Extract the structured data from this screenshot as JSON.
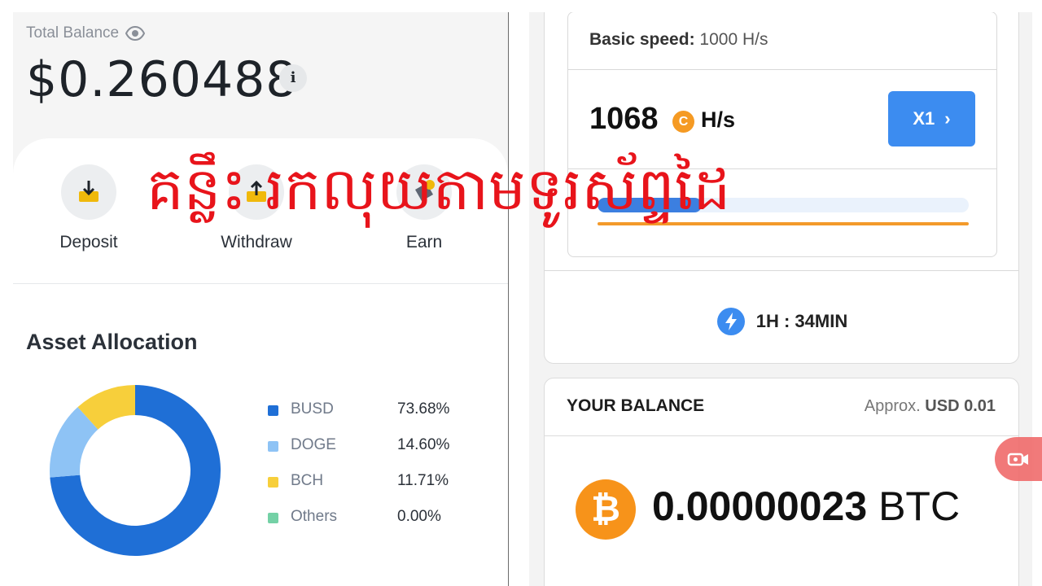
{
  "wallet": {
    "total_balance_label": "Total Balance",
    "balance_value": "$0.260488",
    "info_glyph": "i",
    "actions": [
      {
        "label": "Deposit",
        "icon": "deposit-icon"
      },
      {
        "label": "Withdraw",
        "icon": "withdraw-icon"
      },
      {
        "label": "Earn",
        "icon": "earn-icon"
      }
    ]
  },
  "allocation": {
    "title": "Asset Allocation",
    "items": [
      {
        "name": "BUSD",
        "value": "73.68%",
        "color": "#1f6fd6"
      },
      {
        "name": "DOGE",
        "value": "14.60%",
        "color": "#8ec3f5"
      },
      {
        "name": "BCH",
        "value": "11.71%",
        "color": "#f7cf3b"
      },
      {
        "name": "Others",
        "value": "0.00%",
        "color": "#74d1a6"
      }
    ]
  },
  "chart_data": {
    "type": "pie",
    "categories": [
      "BUSD",
      "DOGE",
      "BCH",
      "Others"
    ],
    "values": [
      73.68,
      14.6,
      11.71,
      0.0
    ],
    "title": "Asset Allocation"
  },
  "miner": {
    "basic_speed_label": "Basic speed:",
    "basic_speed_value": "1000 H/s",
    "speed_number": "1068",
    "speed_coin_glyph": "C",
    "speed_unit": "H/s",
    "boost_button": "X1",
    "boost_chevron": "›",
    "progress_fraction": 0.28,
    "timer": "1H : 34MIN"
  },
  "balance": {
    "title": "YOUR BALANCE",
    "approx_label": "Approx.",
    "approx_value": "USD 0.01",
    "btc_glyph": "₿",
    "amount": "0.00000023",
    "unit": "BTC"
  },
  "overlay": {
    "text": "គន្លឹះ រកលុយតាមទូរស័ព្ទដៃ",
    "color": "#e8141b"
  },
  "colors": {
    "accent_blue": "#3c8cf0",
    "brand_yellow": "#f0b90b",
    "btc_orange": "#f7931a"
  }
}
